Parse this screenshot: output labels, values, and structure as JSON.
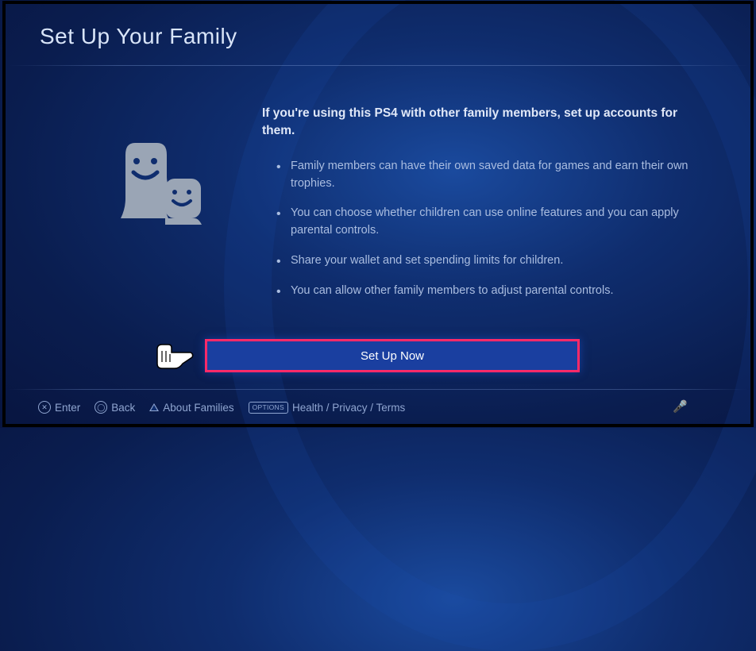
{
  "title": "Set Up Your Family",
  "intro": "If you're using this PS4 with other family members, set up accounts for them.",
  "bullets": [
    "Family members can have their own saved data for games and earn their own trophies.",
    "You can choose whether children can use online features and you can apply parental controls.",
    "Share your wallet and set spending limits for children.",
    "You can allow other family members to adjust parental controls."
  ],
  "action": {
    "label": "Set Up Now"
  },
  "footer": {
    "enter": "Enter",
    "back": "Back",
    "about": "About Families",
    "options_badge": "OPTIONS",
    "legal": "Health / Privacy / Terms"
  }
}
